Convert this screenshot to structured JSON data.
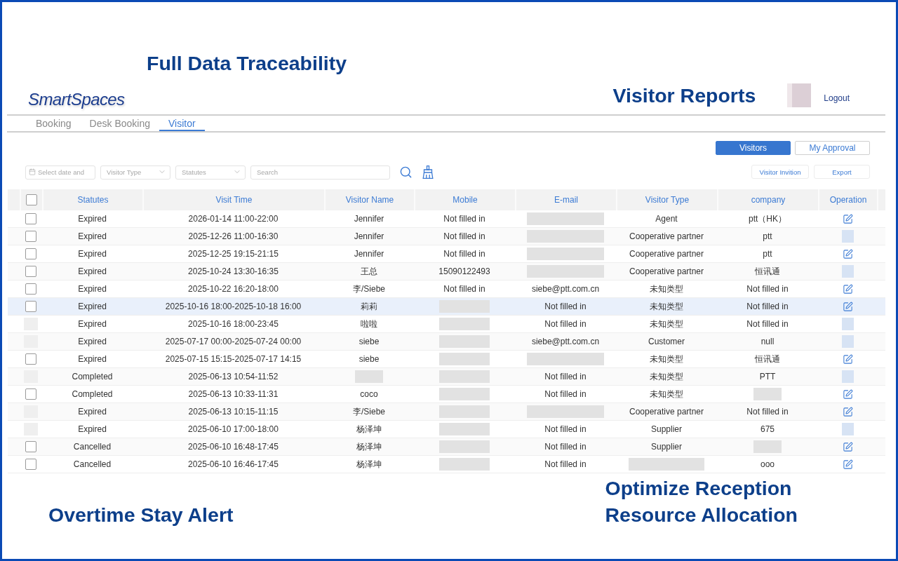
{
  "callouts": {
    "top": "Full Data Traceability",
    "header": "Visitor Reports",
    "bottom_left": "Overtime Stay Alert",
    "bottom_right": [
      "Optimize Reception",
      "Resource Allocation"
    ]
  },
  "header": {
    "logo": "SmartSpaces",
    "logout": "Logout"
  },
  "nav_tabs": [
    {
      "label": "Booking",
      "selected": false
    },
    {
      "label": "Desk Booking",
      "selected": false
    },
    {
      "label": "Visitor",
      "selected": true
    }
  ],
  "view_buttons": [
    {
      "label": "Visitors",
      "selected": true
    },
    {
      "label": "My Approval",
      "selected": false
    }
  ],
  "filters": [
    {
      "kind": "date",
      "placeholder": "Select date and"
    },
    {
      "kind": "select",
      "placeholder": "Visitor Type"
    },
    {
      "kind": "select",
      "placeholder": "Statutes"
    },
    {
      "kind": "search",
      "placeholder": "Search"
    }
  ],
  "actions": [
    {
      "label": "Visitor Invition"
    },
    {
      "label": "Export"
    }
  ],
  "table": {
    "header_checkbox": {
      "checked": false
    },
    "columns": [
      "Statutes",
      "Visit Time",
      "Visitor Name",
      "Mobile",
      "E-mail",
      "Visitor Type",
      "company",
      "Operation"
    ],
    "rows": [
      {
        "hovered": false,
        "select": {
          "kind": "checkbox",
          "checked": false
        },
        "cells": [
          {
            "kind": "text",
            "text": "Expired"
          },
          {
            "kind": "text",
            "text": "2026-01-14 11:00-22:00"
          },
          {
            "kind": "text",
            "text": "Jennifer"
          },
          {
            "kind": "text",
            "text": "Not filled in"
          },
          {
            "kind": "blurred"
          },
          {
            "kind": "text",
            "text": "Agent"
          },
          {
            "kind": "text",
            "text": "ptt（HK）"
          }
        ],
        "operation": {
          "kind": "edit"
        }
      },
      {
        "hovered": false,
        "select": {
          "kind": "checkbox",
          "checked": false
        },
        "cells": [
          {
            "kind": "text",
            "text": "Expired"
          },
          {
            "kind": "text",
            "text": "2025-12-26 11:00-16:30"
          },
          {
            "kind": "text",
            "text": "Jennifer"
          },
          {
            "kind": "text",
            "text": "Not filled in"
          },
          {
            "kind": "blurred"
          },
          {
            "kind": "text",
            "text": "Cooperative partner"
          },
          {
            "kind": "text",
            "text": "ptt"
          }
        ],
        "operation": {
          "kind": "blurred"
        }
      },
      {
        "hovered": false,
        "select": {
          "kind": "checkbox",
          "checked": false
        },
        "cells": [
          {
            "kind": "text",
            "text": "Expired"
          },
          {
            "kind": "text",
            "text": "2025-12-25 19:15-21:15"
          },
          {
            "kind": "text",
            "text": "Jennifer"
          },
          {
            "kind": "text",
            "text": "Not filled in"
          },
          {
            "kind": "blurred"
          },
          {
            "kind": "text",
            "text": "Cooperative partner"
          },
          {
            "kind": "text",
            "text": "ptt"
          }
        ],
        "operation": {
          "kind": "edit"
        }
      },
      {
        "hovered": false,
        "select": {
          "kind": "checkbox",
          "checked": false
        },
        "cells": [
          {
            "kind": "text",
            "text": "Expired"
          },
          {
            "kind": "text",
            "text": "2025-10-24 13:30-16:35"
          },
          {
            "kind": "text",
            "text": "王总"
          },
          {
            "kind": "text",
            "text": "15090122493"
          },
          {
            "kind": "blurred"
          },
          {
            "kind": "text",
            "text": "Cooperative partner"
          },
          {
            "kind": "text",
            "text": "恒讯通"
          }
        ],
        "operation": {
          "kind": "blurred"
        }
      },
      {
        "hovered": false,
        "select": {
          "kind": "checkbox",
          "checked": false
        },
        "cells": [
          {
            "kind": "text",
            "text": "Expired"
          },
          {
            "kind": "text",
            "text": "2025-10-22 16:20-18:00"
          },
          {
            "kind": "text",
            "text": "李/Siebe"
          },
          {
            "kind": "text",
            "text": "Not filled in"
          },
          {
            "kind": "text",
            "text": "siebe@ptt.com.cn"
          },
          {
            "kind": "text",
            "text": "未知类型"
          },
          {
            "kind": "text",
            "text": "Not filled in"
          }
        ],
        "operation": {
          "kind": "edit"
        }
      },
      {
        "hovered": true,
        "select": {
          "kind": "checkbox",
          "checked": false
        },
        "cells": [
          {
            "kind": "text",
            "text": "Expired"
          },
          {
            "kind": "text",
            "text": "2025-10-16 18:00-2025-10-18 16:00"
          },
          {
            "kind": "text",
            "text": "莉莉"
          },
          {
            "kind": "blurred"
          },
          {
            "kind": "text",
            "text": "Not filled in"
          },
          {
            "kind": "text",
            "text": "未知类型"
          },
          {
            "kind": "text",
            "text": "Not filled in"
          }
        ],
        "operation": {
          "kind": "edit"
        }
      },
      {
        "hovered": false,
        "select": {
          "kind": "blurred"
        },
        "cells": [
          {
            "kind": "text",
            "text": "Expired"
          },
          {
            "kind": "text",
            "text": "2025-10-16 18:00-23:45"
          },
          {
            "kind": "text",
            "text": "啦啦"
          },
          {
            "kind": "blurred"
          },
          {
            "kind": "text",
            "text": "Not filled in"
          },
          {
            "kind": "text",
            "text": "未知类型"
          },
          {
            "kind": "text",
            "text": "Not filled in"
          }
        ],
        "operation": {
          "kind": "blurred"
        }
      },
      {
        "hovered": false,
        "select": {
          "kind": "blurred"
        },
        "cells": [
          {
            "kind": "text",
            "text": "Expired"
          },
          {
            "kind": "text",
            "text": "2025-07-17 00:00-2025-07-24 00:00"
          },
          {
            "kind": "text",
            "text": "siebe"
          },
          {
            "kind": "blurred"
          },
          {
            "kind": "text",
            "text": "siebe@ptt.com.cn"
          },
          {
            "kind": "text",
            "text": "Customer"
          },
          {
            "kind": "text",
            "text": "null"
          }
        ],
        "operation": {
          "kind": "blurred"
        }
      },
      {
        "hovered": false,
        "select": {
          "kind": "checkbox",
          "checked": false
        },
        "cells": [
          {
            "kind": "text",
            "text": "Expired"
          },
          {
            "kind": "text",
            "text": "2025-07-15 15:15-2025-07-17 14:15"
          },
          {
            "kind": "text",
            "text": "siebe"
          },
          {
            "kind": "blurred"
          },
          {
            "kind": "blurred"
          },
          {
            "kind": "text",
            "text": "未知类型"
          },
          {
            "kind": "text",
            "text": "恒讯通"
          }
        ],
        "operation": {
          "kind": "edit"
        }
      },
      {
        "hovered": false,
        "select": {
          "kind": "blurred"
        },
        "cells": [
          {
            "kind": "text",
            "text": "Completed"
          },
          {
            "kind": "text",
            "text": "2025-06-13 10:54-11:52"
          },
          {
            "kind": "blurred"
          },
          {
            "kind": "blurred"
          },
          {
            "kind": "text",
            "text": "Not filled in"
          },
          {
            "kind": "text",
            "text": "未知类型"
          },
          {
            "kind": "text",
            "text": "PTT"
          }
        ],
        "operation": {
          "kind": "blurred"
        }
      },
      {
        "hovered": false,
        "select": {
          "kind": "checkbox",
          "checked": false
        },
        "cells": [
          {
            "kind": "text",
            "text": "Completed"
          },
          {
            "kind": "text",
            "text": "2025-06-13 10:33-11:31"
          },
          {
            "kind": "text",
            "text": "coco"
          },
          {
            "kind": "blurred"
          },
          {
            "kind": "text",
            "text": "Not filled in"
          },
          {
            "kind": "text",
            "text": "未知类型"
          },
          {
            "kind": "blurred"
          }
        ],
        "operation": {
          "kind": "edit"
        }
      },
      {
        "hovered": false,
        "select": {
          "kind": "blurred"
        },
        "cells": [
          {
            "kind": "text",
            "text": "Expired"
          },
          {
            "kind": "text",
            "text": "2025-06-13 10:15-11:15"
          },
          {
            "kind": "text",
            "text": "李/Siebe"
          },
          {
            "kind": "blurred"
          },
          {
            "kind": "blurred"
          },
          {
            "kind": "text",
            "text": "Cooperative partner"
          },
          {
            "kind": "text",
            "text": "Not filled in"
          }
        ],
        "operation": {
          "kind": "edit"
        }
      },
      {
        "hovered": false,
        "select": {
          "kind": "blurred"
        },
        "cells": [
          {
            "kind": "text",
            "text": "Expired"
          },
          {
            "kind": "text",
            "text": "2025-06-10 17:00-18:00"
          },
          {
            "kind": "text",
            "text": "杨泽坤"
          },
          {
            "kind": "blurred"
          },
          {
            "kind": "text",
            "text": "Not filled in"
          },
          {
            "kind": "text",
            "text": "Supplier"
          },
          {
            "kind": "text",
            "text": "675"
          }
        ],
        "operation": {
          "kind": "blurred"
        }
      },
      {
        "hovered": false,
        "select": {
          "kind": "checkbox",
          "checked": false
        },
        "cells": [
          {
            "kind": "text",
            "text": "Cancelled"
          },
          {
            "kind": "text",
            "text": "2025-06-10 16:48-17:45"
          },
          {
            "kind": "text",
            "text": "杨泽坤"
          },
          {
            "kind": "blurred"
          },
          {
            "kind": "text",
            "text": "Not filled in"
          },
          {
            "kind": "text",
            "text": "Supplier"
          },
          {
            "kind": "blurred"
          }
        ],
        "operation": {
          "kind": "edit"
        }
      },
      {
        "hovered": false,
        "select": {
          "kind": "checkbox",
          "checked": false
        },
        "cells": [
          {
            "kind": "text",
            "text": "Cancelled"
          },
          {
            "kind": "text",
            "text": "2025-06-10 16:46-17:45"
          },
          {
            "kind": "text",
            "text": "杨泽坤"
          },
          {
            "kind": "blurred"
          },
          {
            "kind": "text",
            "text": "Not filled in"
          },
          {
            "kind": "blurred"
          },
          {
            "kind": "text",
            "text": "ooo"
          }
        ],
        "operation": {
          "kind": "edit"
        }
      }
    ]
  }
}
